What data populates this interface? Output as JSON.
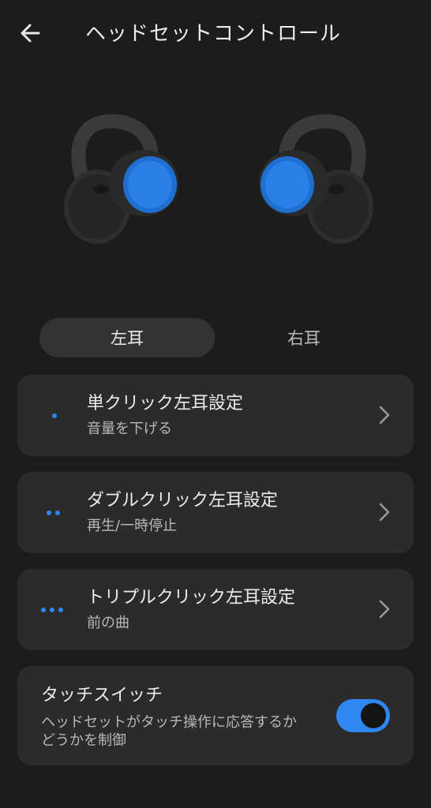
{
  "header": {
    "title": "ヘッドセットコントロール",
    "back_icon": "arrow-left-icon"
  },
  "images": {
    "left_earbud": "left-earbud-image",
    "right_earbud": "right-earbud-image"
  },
  "tabs": {
    "left": "左耳",
    "right": "右耳",
    "selected": "左耳"
  },
  "settings": [
    {
      "title": "単クリック左耳設定",
      "value": "音量を下げる",
      "dots": 1
    },
    {
      "title": "ダブルクリック左耳設定",
      "value": "再生/一時停止",
      "dots": 2
    },
    {
      "title": "トリプルクリック左耳設定",
      "value": "前の曲",
      "dots": 3
    }
  ],
  "touch_switch": {
    "title": "タッチスイッチ",
    "description": "ヘッドセットがタッチ操作に応答するかどうかを制御",
    "enabled": true
  },
  "colors": {
    "background": "#1c1c1c",
    "card": "#2b2b2b",
    "accent": "#2f87f0",
    "text_primary": "#ececec",
    "text_secondary": "#b8b8b8"
  }
}
